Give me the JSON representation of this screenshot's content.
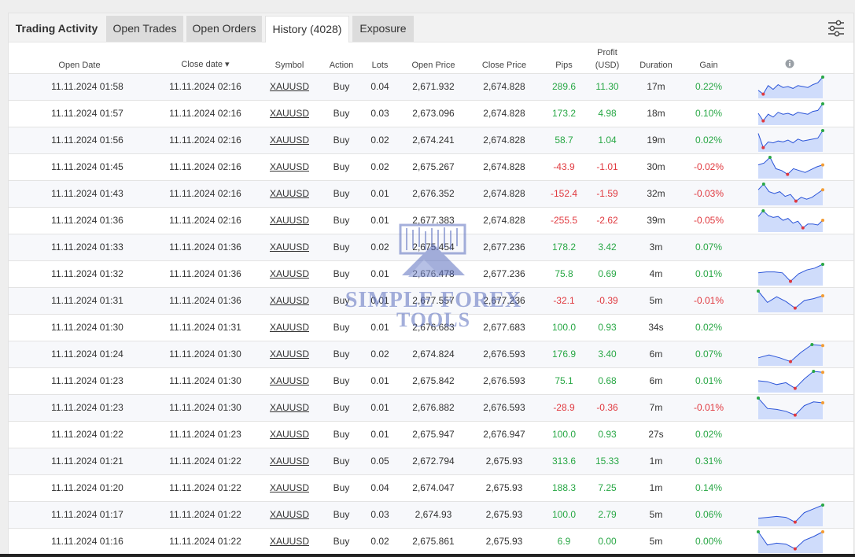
{
  "tabs": {
    "title": "Trading Activity",
    "open_trades": "Open Trades",
    "open_orders": "Open Orders",
    "history": "History (4028)",
    "exposure": "Exposure"
  },
  "headers": {
    "open_date": "Open Date",
    "close_date": "Close date ▾",
    "symbol": "Symbol",
    "action": "Action",
    "lots": "Lots",
    "open_price": "Open Price",
    "close_price": "Close Price",
    "pips": "Pips",
    "profit_line1": "Profit",
    "profit_line2": "(USD)",
    "duration": "Duration",
    "gain": "Gain",
    "info_icon": "info-icon"
  },
  "watermark": {
    "line1": "SIMPLE FOREX",
    "line2": "TOOLS"
  },
  "colors": {
    "positive": "#28a745",
    "negative": "#e0383e",
    "spark_fill": "#cfdcfb",
    "spark_line": "#2c55d8"
  },
  "rows": [
    {
      "open_date": "11.11.2024 01:58",
      "close_date": "11.11.2024 02:16",
      "symbol": "XAUUSD",
      "action": "Buy",
      "lots": "0.04",
      "open_price": "2,671.932",
      "close_price": "2,674.828",
      "pips": "289.6",
      "profit": "11.30",
      "duration": "17m",
      "gain": "0.22%",
      "sign": "pos",
      "spark": [
        0.3,
        0.1,
        0.55,
        0.35,
        0.6,
        0.45,
        0.5,
        0.4,
        0.55,
        0.5,
        0.45,
        0.6,
        0.7,
        1.0
      ]
    },
    {
      "open_date": "11.11.2024 01:57",
      "close_date": "11.11.2024 02:16",
      "symbol": "XAUUSD",
      "action": "Buy",
      "lots": "0.03",
      "open_price": "2,673.096",
      "close_price": "2,674.828",
      "pips": "173.2",
      "profit": "4.98",
      "duration": "18m",
      "gain": "0.10%",
      "sign": "pos",
      "spark": [
        0.5,
        0.1,
        0.45,
        0.3,
        0.55,
        0.45,
        0.5,
        0.4,
        0.55,
        0.5,
        0.45,
        0.6,
        0.65,
        1.0
      ]
    },
    {
      "open_date": "11.11.2024 01:56",
      "close_date": "11.11.2024 02:16",
      "symbol": "XAUUSD",
      "action": "Buy",
      "lots": "0.02",
      "open_price": "2,674.241",
      "close_price": "2,674.828",
      "pips": "58.7",
      "profit": "1.04",
      "duration": "19m",
      "gain": "0.02%",
      "sign": "pos",
      "spark": [
        0.85,
        0.1,
        0.4,
        0.35,
        0.45,
        0.4,
        0.5,
        0.35,
        0.55,
        0.45,
        0.5,
        0.55,
        0.6,
        1.0
      ]
    },
    {
      "open_date": "11.11.2024 01:45",
      "close_date": "11.11.2024 02:16",
      "symbol": "XAUUSD",
      "action": "Buy",
      "lots": "0.02",
      "open_price": "2,675.267",
      "close_price": "2,674.828",
      "pips": "-43.9",
      "profit": "-1.01",
      "duration": "30m",
      "gain": "-0.02%",
      "sign": "neg",
      "spark": [
        0.6,
        0.7,
        1.0,
        0.4,
        0.3,
        0.1,
        0.4,
        0.3,
        0.2,
        0.35,
        0.5,
        0.6
      ]
    },
    {
      "open_date": "11.11.2024 01:43",
      "close_date": "11.11.2024 02:16",
      "symbol": "XAUUSD",
      "action": "Buy",
      "lots": "0.01",
      "open_price": "2,676.352",
      "close_price": "2,674.828",
      "pips": "-152.4",
      "profit": "-1.59",
      "duration": "32m",
      "gain": "-0.03%",
      "sign": "neg",
      "spark": [
        0.7,
        1.0,
        0.6,
        0.5,
        0.6,
        0.35,
        0.45,
        0.1,
        0.3,
        0.2,
        0.3,
        0.5,
        0.7
      ]
    },
    {
      "open_date": "11.11.2024 01:36",
      "close_date": "11.11.2024 02:16",
      "symbol": "XAUUSD",
      "action": "Buy",
      "lots": "0.01",
      "open_price": "2,677.383",
      "close_price": "2,674.828",
      "pips": "-255.5",
      "profit": "-2.62",
      "duration": "39m",
      "gain": "-0.05%",
      "sign": "neg",
      "spark": [
        0.7,
        1.0,
        0.75,
        0.65,
        0.7,
        0.5,
        0.6,
        0.35,
        0.45,
        0.1,
        0.3,
        0.3,
        0.25,
        0.5
      ]
    },
    {
      "open_date": "11.11.2024 01:33",
      "close_date": "11.11.2024 01:36",
      "symbol": "XAUUSD",
      "action": "Buy",
      "lots": "0.02",
      "open_price": "2,675.454",
      "close_price": "2,677.236",
      "pips": "178.2",
      "profit": "3.42",
      "duration": "3m",
      "gain": "0.07%",
      "sign": "pos",
      "spark": null
    },
    {
      "open_date": "11.11.2024 01:32",
      "close_date": "11.11.2024 01:36",
      "symbol": "XAUUSD",
      "action": "Buy",
      "lots": "0.01",
      "open_price": "2,676.478",
      "close_price": "2,677.236",
      "pips": "75.8",
      "profit": "0.69",
      "duration": "4m",
      "gain": "0.01%",
      "sign": "pos",
      "spark": [
        0.55,
        0.6,
        0.6,
        0.55,
        0.1,
        0.5,
        0.7,
        0.8,
        1.0
      ]
    },
    {
      "open_date": "11.11.2024 01:31",
      "close_date": "11.11.2024 01:36",
      "symbol": "XAUUSD",
      "action": "Buy",
      "lots": "0.01",
      "open_price": "2,677.557",
      "close_price": "2,677.236",
      "pips": "-32.1",
      "profit": "-0.39",
      "duration": "5m",
      "gain": "-0.01%",
      "sign": "neg",
      "spark": [
        1.0,
        0.4,
        0.7,
        0.45,
        0.1,
        0.5,
        0.6,
        0.75
      ]
    },
    {
      "open_date": "11.11.2024 01:30",
      "close_date": "11.11.2024 01:31",
      "symbol": "XAUUSD",
      "action": "Buy",
      "lots": "0.01",
      "open_price": "2,676.683",
      "close_price": "2,677.683",
      "pips": "100.0",
      "profit": "0.93",
      "duration": "34s",
      "gain": "0.02%",
      "sign": "pos",
      "spark": null
    },
    {
      "open_date": "11.11.2024 01:24",
      "close_date": "11.11.2024 01:30",
      "symbol": "XAUUSD",
      "action": "Buy",
      "lots": "0.02",
      "open_price": "2,674.824",
      "close_price": "2,676.593",
      "pips": "176.9",
      "profit": "3.40",
      "duration": "6m",
      "gain": "0.07%",
      "sign": "pos",
      "spark": [
        0.3,
        0.45,
        0.3,
        0.1,
        0.6,
        1.0,
        0.95
      ]
    },
    {
      "open_date": "11.11.2024 01:23",
      "close_date": "11.11.2024 01:30",
      "symbol": "XAUUSD",
      "action": "Buy",
      "lots": "0.01",
      "open_price": "2,675.842",
      "close_price": "2,676.593",
      "pips": "75.1",
      "profit": "0.68",
      "duration": "6m",
      "gain": "0.01%",
      "sign": "pos",
      "spark": [
        0.5,
        0.45,
        0.3,
        0.4,
        0.1,
        0.6,
        1.0,
        0.95
      ]
    },
    {
      "open_date": "11.11.2024 01:23",
      "close_date": "11.11.2024 01:30",
      "symbol": "XAUUSD",
      "action": "Buy",
      "lots": "0.01",
      "open_price": "2,676.882",
      "close_price": "2,676.593",
      "pips": "-28.9",
      "profit": "-0.36",
      "duration": "7m",
      "gain": "-0.01%",
      "sign": "neg",
      "spark": [
        1.0,
        0.45,
        0.4,
        0.3,
        0.1,
        0.6,
        0.8,
        0.75
      ]
    },
    {
      "open_date": "11.11.2024 01:22",
      "close_date": "11.11.2024 01:23",
      "symbol": "XAUUSD",
      "action": "Buy",
      "lots": "0.01",
      "open_price": "2,675.947",
      "close_price": "2,676.947",
      "pips": "100.0",
      "profit": "0.93",
      "duration": "27s",
      "gain": "0.02%",
      "sign": "pos",
      "spark": null
    },
    {
      "open_date": "11.11.2024 01:21",
      "close_date": "11.11.2024 01:22",
      "symbol": "XAUUSD",
      "action": "Buy",
      "lots": "0.05",
      "open_price": "2,672.794",
      "close_price": "2,675.93",
      "pips": "313.6",
      "profit": "15.33",
      "duration": "1m",
      "gain": "0.31%",
      "sign": "pos",
      "spark": null
    },
    {
      "open_date": "11.11.2024 01:20",
      "close_date": "11.11.2024 01:22",
      "symbol": "XAUUSD",
      "action": "Buy",
      "lots": "0.04",
      "open_price": "2,674.047",
      "close_price": "2,675.93",
      "pips": "188.3",
      "profit": "7.25",
      "duration": "1m",
      "gain": "0.14%",
      "sign": "pos",
      "spark": null
    },
    {
      "open_date": "11.11.2024 01:17",
      "close_date": "11.11.2024 01:22",
      "symbol": "XAUUSD",
      "action": "Buy",
      "lots": "0.03",
      "open_price": "2,674.93",
      "close_price": "2,675.93",
      "pips": "100.0",
      "profit": "2.79",
      "duration": "5m",
      "gain": "0.06%",
      "sign": "pos",
      "spark": [
        0.3,
        0.35,
        0.4,
        0.35,
        0.1,
        0.6,
        0.8,
        1.0
      ]
    },
    {
      "open_date": "11.11.2024 01:16",
      "close_date": "11.11.2024 01:22",
      "symbol": "XAUUSD",
      "action": "Buy",
      "lots": "0.02",
      "open_price": "2,675.861",
      "close_price": "2,675.93",
      "pips": "6.9",
      "profit": "0.00",
      "duration": "5m",
      "gain": "0.00%",
      "sign": "pos",
      "spark": [
        1.0,
        0.3,
        0.4,
        0.35,
        0.1,
        0.55,
        0.75,
        1.0
      ]
    }
  ]
}
